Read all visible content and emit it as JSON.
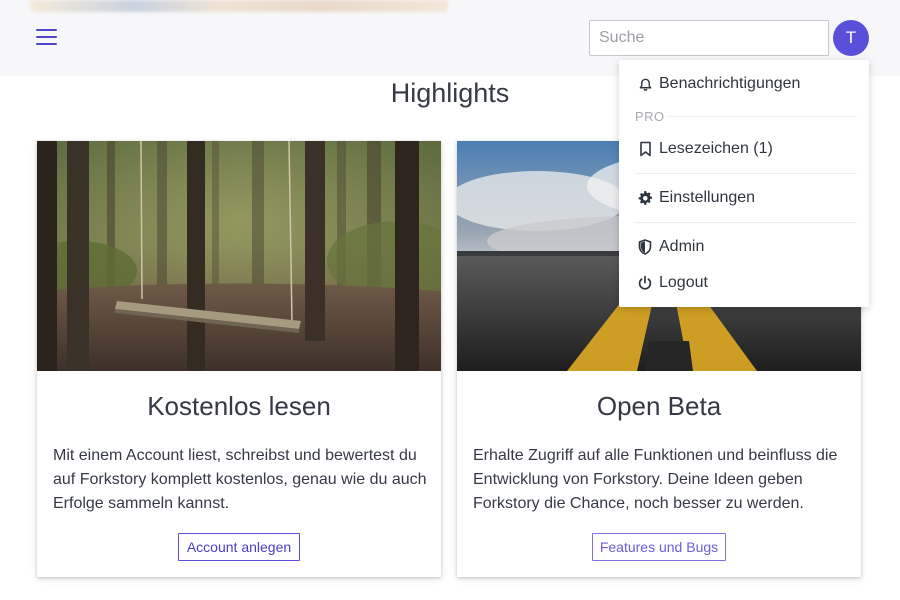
{
  "header": {
    "search_placeholder": "Suche",
    "avatar_initial": "T"
  },
  "section": {
    "title": "Highlights"
  },
  "cards": [
    {
      "title": "Kostenlos lesen",
      "text": "Mit einem Account liest, schreibst und bewertest du auf Forkstory komplett kostenlos, genau wie du auch Erfolge sammeln kannst.",
      "button": "Account anlegen"
    },
    {
      "title": "Open Beta",
      "text": "Erhalte Zugriff auf alle Funktionen und beinfluss die Entwicklung von Forkstory. Deine Ideen geben Forkstory die Chance, noch besser zu werden.",
      "button": "Features und Bugs"
    }
  ],
  "dropdown": {
    "notifications": "Benachrichtigungen",
    "pro_label": "PRO",
    "bookmarks": "Lesezeichen (1)",
    "settings": "Einstellungen",
    "admin": "Admin",
    "logout": "Logout"
  },
  "colors": {
    "accent": "#5a4fd8",
    "text": "#2f3640"
  }
}
